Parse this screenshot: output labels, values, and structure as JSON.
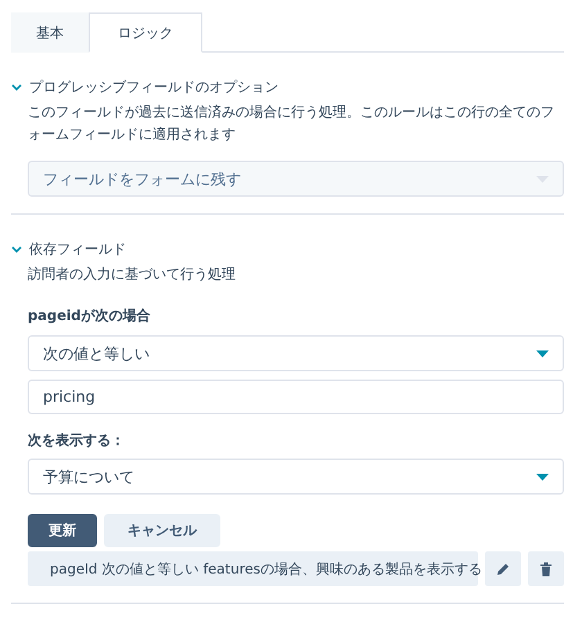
{
  "tabs": [
    {
      "label": "基本",
      "selected": false
    },
    {
      "label": "ロジック",
      "selected": true
    }
  ],
  "sections": [
    {
      "title": "プログレッシブフィールドのオプション",
      "expanded": true,
      "description": "このフィールドが過去に送信済みの場合に行う処理。このルールはこの行の全てのフォームフィールドに適用されます",
      "select": {
        "value": "フィールドをフォームに残す",
        "disabled": true
      }
    },
    {
      "title": "依存フィールド",
      "expanded": true,
      "description": "訪問者の入力に基づいて行う処理"
    }
  ],
  "rule_editor": {
    "condition_label": "pageidが次の場合",
    "operator": "次の値と等しい",
    "value": "pricing",
    "show_label": "次を表示する：",
    "show_field": "予算について",
    "buttons": [
      {
        "label": "更新",
        "kind": "primary"
      },
      {
        "label": "キャンセル",
        "kind": "secondary"
      }
    ]
  },
  "rules": [
    {
      "text": "pageId 次の値と等しい featuresの場合、興味のある製品を表示する"
    }
  ]
}
